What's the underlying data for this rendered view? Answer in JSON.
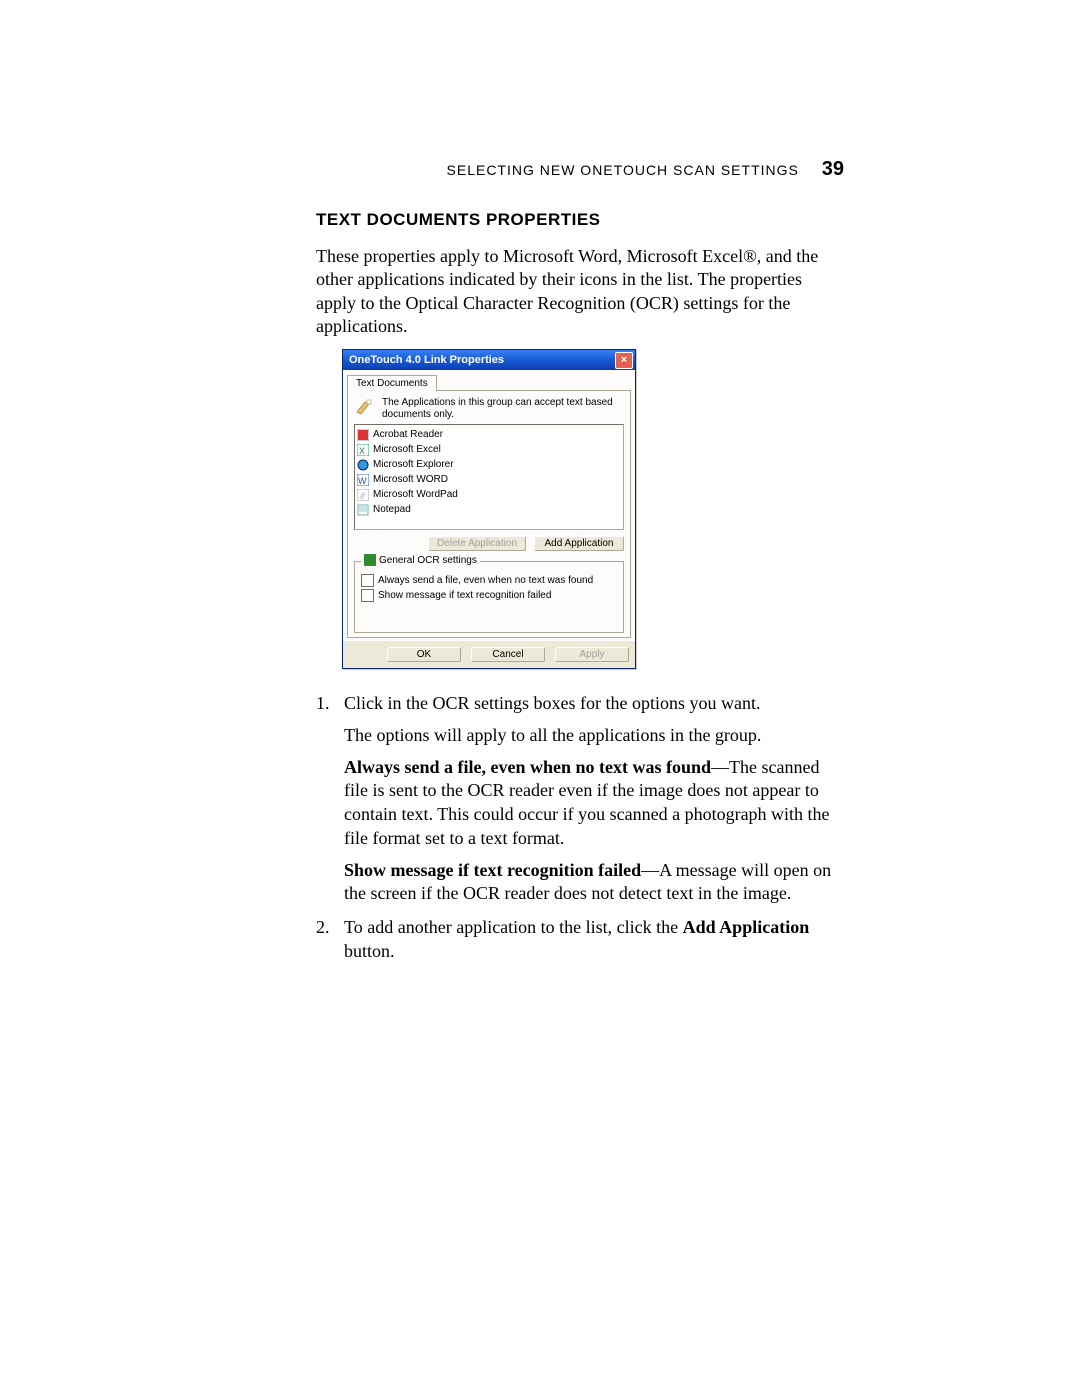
{
  "header": {
    "running_head": "SELECTING NEW ONETOUCH SCAN SETTINGS",
    "page_number": "39"
  },
  "section": {
    "title": "TEXT DOCUMENTS PROPERTIES",
    "intro": "These properties apply to Microsoft Word, Microsoft Excel®, and the other applications indicated by their icons in the list. The properties apply to the Optical Character Recognition (OCR) settings for the applications."
  },
  "dialog": {
    "title": "OneTouch 4.0 Link Properties",
    "tab": "Text Documents",
    "hint": "The Applications in this group can accept text based documents only.",
    "apps": [
      "Acrobat Reader",
      "Microsoft Excel",
      "Microsoft Explorer",
      "Microsoft WORD",
      "Microsoft WordPad",
      "Notepad"
    ],
    "delete_btn": "Delete Application",
    "add_btn": "Add Application",
    "group_legend": "General OCR settings",
    "chk1": "Always send a file, even when no text was found",
    "chk2": "Show message if text recognition failed",
    "ok": "OK",
    "cancel": "Cancel",
    "apply": "Apply"
  },
  "steps": {
    "s1_num": "1.",
    "s1_text": "Click in the OCR settings boxes for the options you want.",
    "s1_sub1": "The options will apply to all the applications in the group.",
    "s1_b1_bold": "Always send a file, even when no text was found",
    "s1_b1_rest": "—The scanned file is sent to the OCR reader even if the image does not appear to contain text. This could occur if you scanned a photograph with the file format set to a text format.",
    "s1_b2_bold": "Show message if text recognition failed",
    "s1_b2_rest": "—A message will open on the screen if the OCR reader does not detect text in the image.",
    "s2_num": "2.",
    "s2_text_a": "To add another application to the list, click the ",
    "s2_text_bold": "Add Application",
    "s2_text_b": " button."
  }
}
